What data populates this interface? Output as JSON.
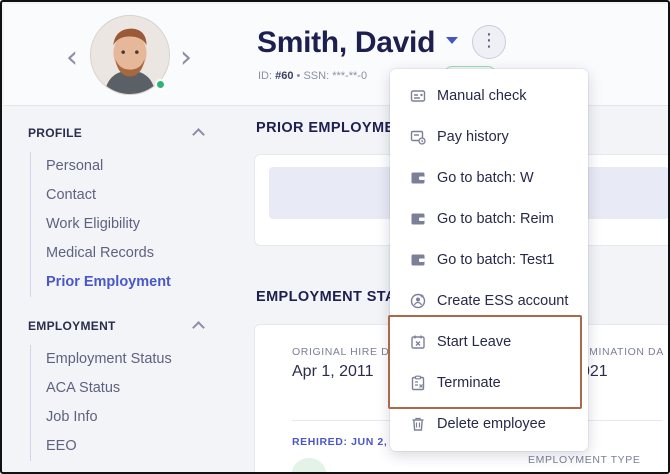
{
  "employee": {
    "name": "Smith, David",
    "id_label": "ID:",
    "id_value": "#60",
    "ssn_label": "SSN:",
    "ssn_value": "***-**-0"
  },
  "sidebar": {
    "profile": {
      "heading": "PROFILE",
      "items": [
        "Personal",
        "Contact",
        "Work Eligibility",
        "Medical Records",
        "Prior Employment"
      ],
      "active": "Prior Employment"
    },
    "employment": {
      "heading": "EMPLOYMENT",
      "items": [
        "Employment Status",
        "ACA Status",
        "Job Info",
        "EEO"
      ]
    }
  },
  "main": {
    "prior_title": "PRIOR EMPLOYME",
    "status_title": "EMPLOYMENT STA",
    "original_hire_label": "ORIGINAL HIRE D",
    "original_hire_value": "Apr 1, 2011",
    "termination_label": "RMINATION DA",
    "termination_value": "021",
    "rehired_label": "REHIRED: JUN 2,",
    "employment_type_label": "EMPLOYMENT TYPE"
  },
  "menu": {
    "items": [
      {
        "label": "Manual check",
        "icon": "check-icon"
      },
      {
        "label": "Pay history",
        "icon": "pay-history-icon"
      },
      {
        "label": "Go to batch: W",
        "icon": "wallet-icon"
      },
      {
        "label": "Go to batch: Reim",
        "icon": "wallet-icon"
      },
      {
        "label": "Go to batch: Test1",
        "icon": "wallet-icon"
      },
      {
        "label": "Create ESS account",
        "icon": "user-add-icon"
      },
      {
        "label": "Start Leave",
        "icon": "calendar-x-icon"
      },
      {
        "label": "Terminate",
        "icon": "clipboard-x-icon"
      },
      {
        "label": "Delete employee",
        "icon": "trash-icon"
      }
    ],
    "highlighted": [
      "Start Leave",
      "Terminate"
    ]
  },
  "colors": {
    "accent": "#4a57c6",
    "title": "#1d1f4f",
    "highlight_border": "#a96a4a",
    "online": "#2bb673"
  }
}
